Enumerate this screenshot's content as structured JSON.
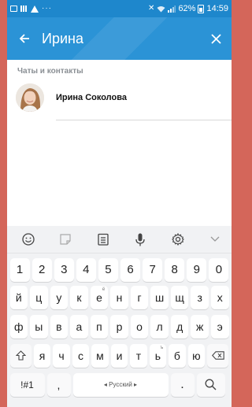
{
  "status_bar": {
    "battery": "62%",
    "time": "14:59"
  },
  "app_bar": {
    "search_query": "Ирина",
    "back_icon": "arrow-left-icon",
    "close_icon": "close-icon"
  },
  "results": {
    "section_title": "Чаты и контакты",
    "contacts": [
      {
        "name": "Ирина Соколова"
      }
    ]
  },
  "keyboard": {
    "numbers": [
      "1",
      "2",
      "3",
      "4",
      "5",
      "6",
      "7",
      "8",
      "9",
      "0"
    ],
    "row1": [
      "й",
      "ц",
      "у",
      "к",
      "е",
      "н",
      "г",
      "ш",
      "щ",
      "з",
      "х"
    ],
    "row1_hints": [
      "",
      "",
      "",
      "",
      "ё",
      "",
      "",
      "",
      "",
      "",
      ""
    ],
    "row2": [
      "ф",
      "ы",
      "в",
      "а",
      "п",
      "р",
      "о",
      "л",
      "д",
      "ж",
      "э"
    ],
    "row3": [
      "я",
      "ч",
      "с",
      "м",
      "и",
      "т",
      "ь",
      "б",
      "ю"
    ],
    "row3_hints": [
      "",
      "",
      "",
      "",
      "",
      "",
      "ъ",
      "",
      ""
    ],
    "symbols_label": "!#1",
    "comma_label": ",",
    "space_label": "◂ Русский ▸",
    "dot_label": "."
  },
  "colors": {
    "status_bar": "#1e87cc",
    "app_bar": "#2b93d6",
    "background": "#d4665a"
  }
}
